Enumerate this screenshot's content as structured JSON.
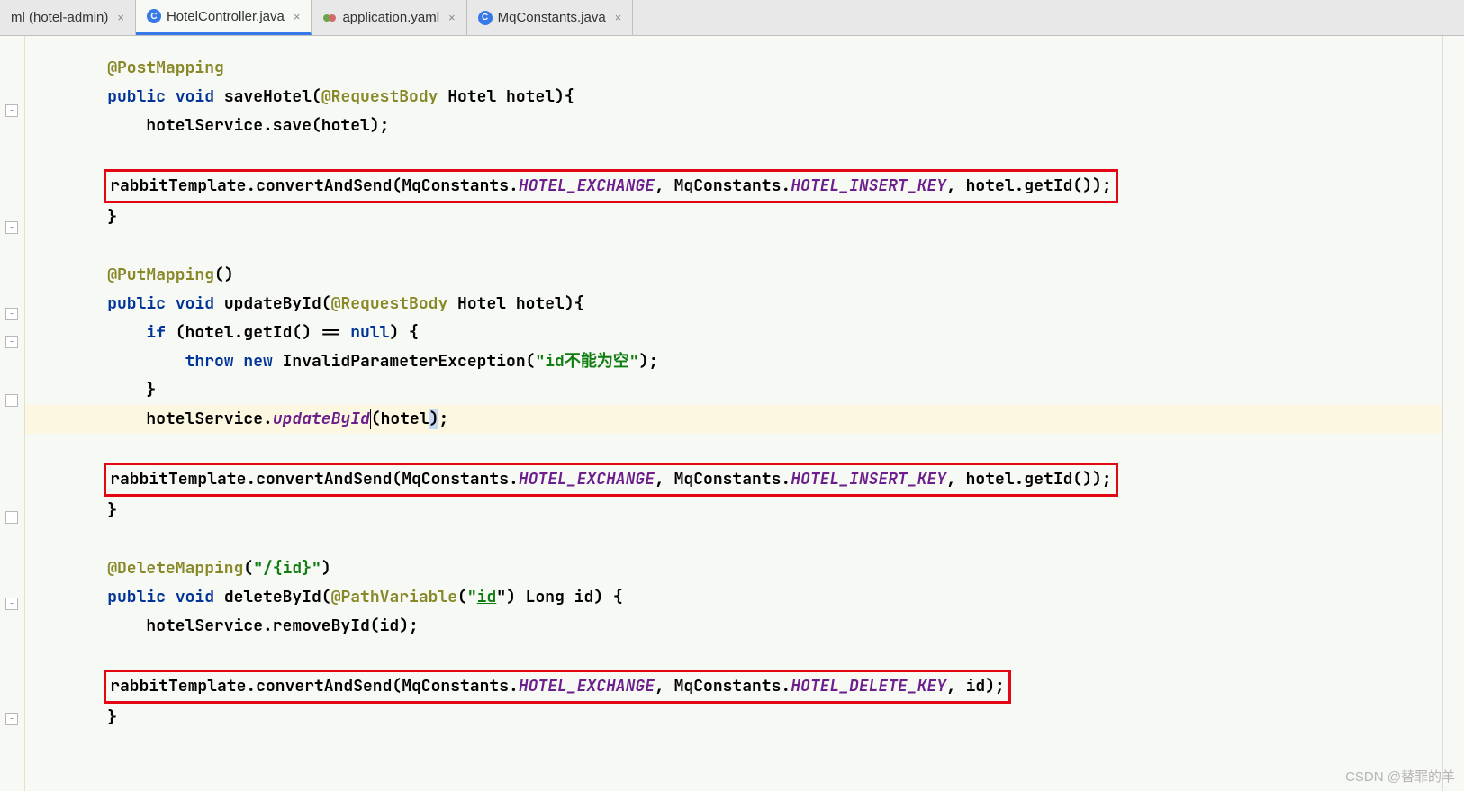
{
  "tabs": [
    {
      "label": "ml (hotel-admin)",
      "icon_bg": "none",
      "icon_text": "",
      "active": false,
      "closeable": true
    },
    {
      "label": "HotelController.java",
      "icon_bg": "#3879ea",
      "icon_text": "C",
      "active": true,
      "closeable": true
    },
    {
      "label": "application.yaml",
      "icon_bg": "yaml",
      "icon_text": "",
      "active": false,
      "closeable": true
    },
    {
      "label": "MqConstants.java",
      "icon_bg": "#3879ea",
      "icon_text": "C",
      "active": false,
      "closeable": true
    }
  ],
  "code": {
    "l1_anno": "@PostMapping",
    "l2_public": "public",
    "l2_void": "void",
    "l2_method": " saveHotel(",
    "l2_reqbody": "@RequestBody",
    "l2_rest": " Hotel hotel){",
    "l3": "        hotelService.save(hotel);",
    "l4_empty": "",
    "box1": {
      "pre": "rabbitTemplate.convertAndSend(MqConstants.",
      "c1": "HOTEL_EXCHANGE",
      "mid": ", MqConstants.",
      "c2": "HOTEL_INSERT_KEY",
      "tail": ", hotel.getId());"
    },
    "l6": "    }",
    "l7_empty": "",
    "l8_anno": "@PutMapping",
    "l8_rest": "()",
    "l9_public": "public",
    "l9_void": "void",
    "l9_method": " updateById(",
    "l9_reqbody": "@RequestBody",
    "l9_rest": " Hotel hotel){",
    "l10_if": "if",
    "l10_cond": " (hotel.getId() == ",
    "l10_null": "null",
    "l10_rest": ") {",
    "l11_throw": "throw",
    "l11_new": "new",
    "l11_exc": " InvalidParameterException(",
    "l11_str": "\"id不能为空\"",
    "l11_end": ");",
    "l12": "        }",
    "l13_pre": "        hotelService.",
    "l13_upd": "updateById",
    "l13_open": "(hotel",
    "l13_close": ")",
    "l13_semi": ";",
    "l14_empty": "",
    "box2": {
      "pre": "rabbitTemplate.convertAndSend(MqConstants.",
      "c1": "HOTEL_EXCHANGE",
      "mid": ", MqConstants.",
      "c2": "HOTEL_INSERT_KEY",
      "tail": ", hotel.getId());"
    },
    "l16": "    }",
    "l17_empty": "",
    "l18_anno": "@DeleteMapping",
    "l18_open": "(",
    "l18_str1": "\"/",
    "l18_pv": "{id}",
    "l18_str2": "\"",
    "l18_close": ")",
    "l19_public": "public",
    "l19_void": "void",
    "l19_method": " deleteById(",
    "l19_pathvar": "@PathVariable",
    "l19_open": "(",
    "l19_str": "\"",
    "l19_idref": "id",
    "l19_close": "\") Long id) {",
    "l20": "        hotelService.removeById(id);",
    "l21_empty": "",
    "box3": {
      "pre": "rabbitTemplate.convertAndSend(MqConstants.",
      "c1": "HOTEL_EXCHANGE",
      "mid": ", MqConstants.",
      "c2": "HOTEL_DELETE_KEY",
      "tail": ", id);"
    },
    "l23": "    }"
  },
  "fold_positions": [
    76,
    302,
    430,
    558
  ],
  "watermark": "CSDN @替罪的羊"
}
